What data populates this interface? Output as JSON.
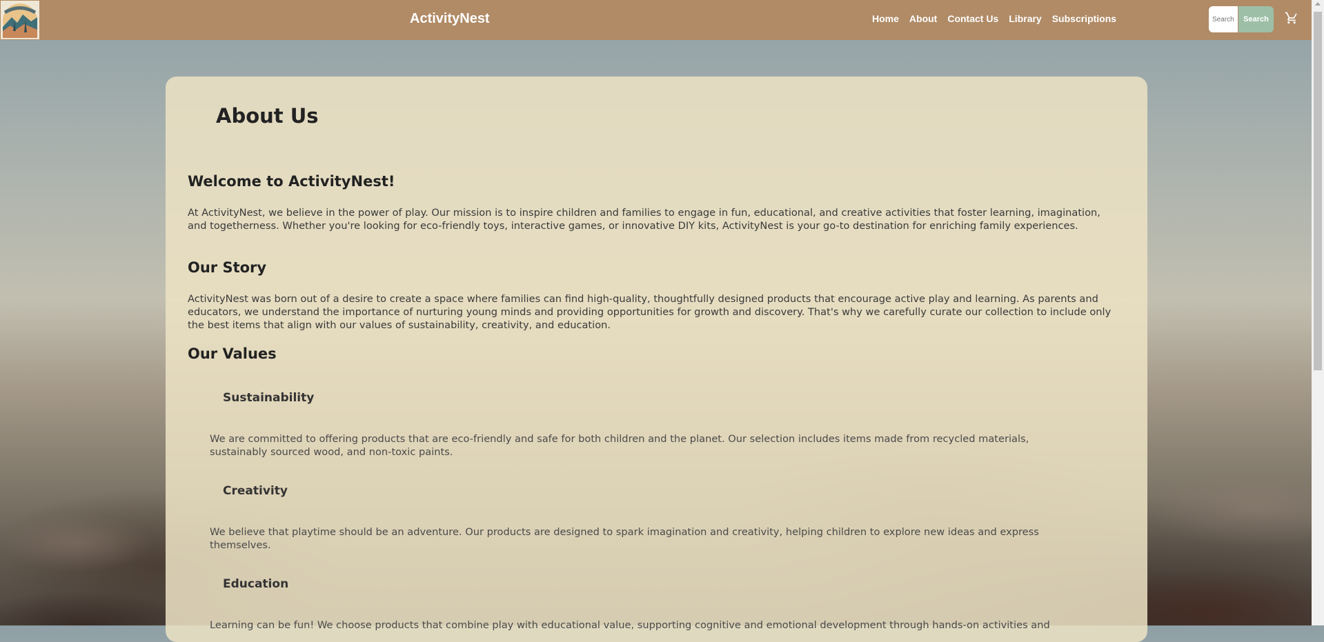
{
  "header": {
    "brand": "ActivityNest",
    "nav": [
      "Home",
      "About",
      "Contact Us",
      "Library",
      "Subscriptions"
    ],
    "search_placeholder": "Search",
    "search_button": "Search",
    "icons": {
      "logo": "mountain-sunset-logo",
      "cart": "cart-icon"
    }
  },
  "page": {
    "title": "About Us",
    "welcome_heading": "Welcome to ActivityNest!",
    "welcome_text": "At ActivityNest, we believe in the power of play. Our mission is to inspire children and families to engage in fun, educational, and creative activities that foster learning, imagination, and togetherness. Whether you're looking for eco-friendly toys, interactive games, or innovative DIY kits, ActivityNest is your go-to destination for enriching family experiences.",
    "story_heading": "Our Story",
    "story_text": "ActivityNest was born out of a desire to create a space where families can find high-quality, thoughtfully designed products that encourage active play and learning. As parents and educators, we understand the importance of nurturing young minds and providing opportunities for growth and discovery. That's why we carefully curate our collection to include only the best items that align with our values of sustainability, creativity, and education.",
    "values_heading": "Our Values",
    "values": [
      {
        "title": "Sustainability",
        "text": "We are committed to offering products that are eco-friendly and safe for both children and the planet. Our selection includes items made from recycled materials, sustainably sourced wood, and non-toxic paints."
      },
      {
        "title": "Creativity",
        "text": "We believe that playtime should be an adventure. Our products are designed to spark imagination and creativity, helping children to explore new ideas and express themselves."
      },
      {
        "title": "Education",
        "text": "Learning can be fun! We choose products that combine play with educational value, supporting cognitive and emotional development through hands-on activities and"
      }
    ]
  },
  "colors": {
    "header": "#b08b66",
    "search_button": "#9dbfa7",
    "card": "#ece2c4"
  }
}
